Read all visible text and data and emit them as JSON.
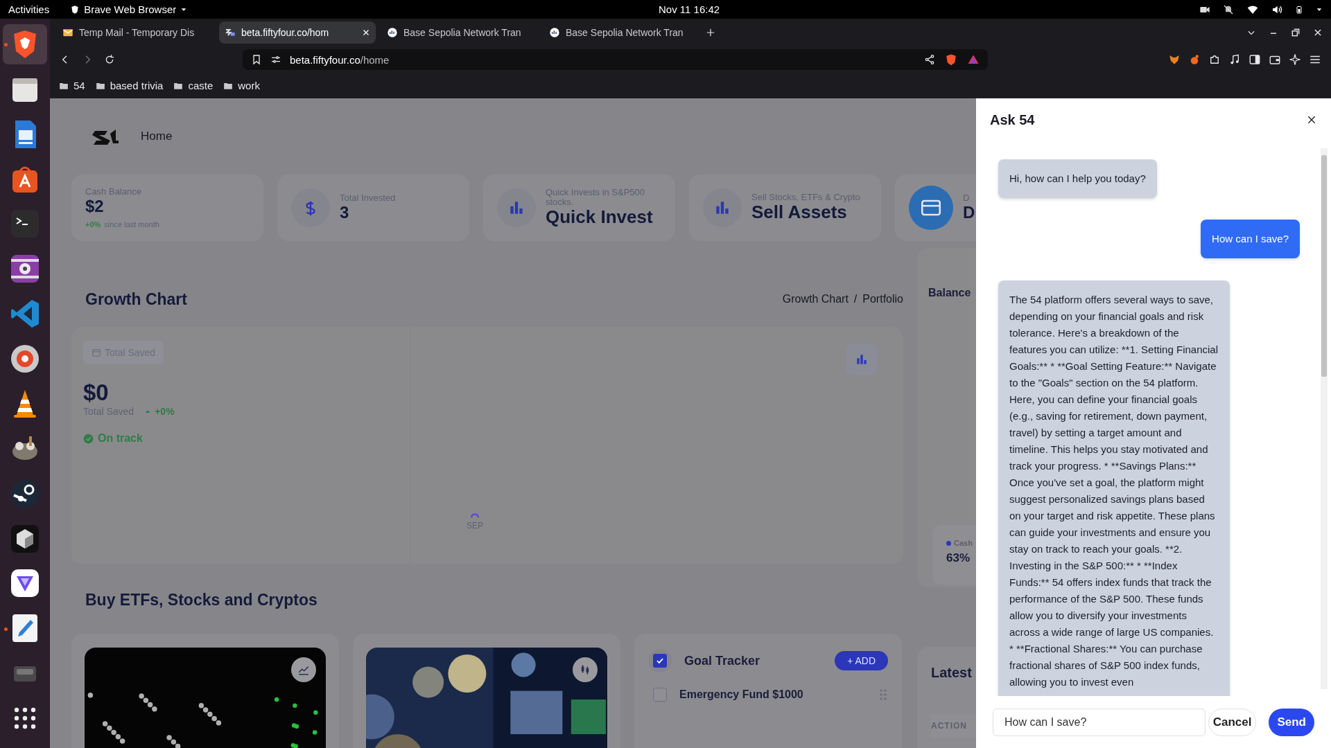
{
  "top_bar": {
    "activities": "Activities",
    "app_menu": "Brave Web Browser",
    "clock": "Nov 11  16:42"
  },
  "dock": [
    {
      "kind": "browser",
      "running": true
    },
    {
      "kind": "files",
      "running": false
    },
    {
      "kind": "writer",
      "running": false
    },
    {
      "kind": "store",
      "running": false
    },
    {
      "kind": "terminal",
      "running": false
    },
    {
      "kind": "video",
      "running": false
    },
    {
      "kind": "code",
      "running": false
    },
    {
      "kind": "disc",
      "running": false
    },
    {
      "kind": "cone",
      "running": false
    },
    {
      "kind": "paint",
      "running": false
    },
    {
      "kind": "gear",
      "running": false
    },
    {
      "kind": "cube",
      "running": false
    },
    {
      "kind": "triangle",
      "running": false
    },
    {
      "kind": "pencil",
      "running": true
    },
    {
      "kind": "drive",
      "running": false
    },
    {
      "kind": "grid",
      "running": false
    }
  ],
  "browser": {
    "tabs": [
      {
        "title": "Temp Mail - Temporary Dis",
        "selected": false,
        "kind": "mail"
      },
      {
        "title": "beta.fiftyfour.co/hom",
        "selected": true,
        "kind": "site"
      },
      {
        "title": "Base Sepolia Network Tran",
        "selected": false,
        "kind": "scan"
      },
      {
        "title": "Base Sepolia Network Tran",
        "selected": false,
        "kind": "scan"
      }
    ],
    "url_host": "beta.fiftyfour.co",
    "url_path": "/home",
    "bookmarks": [
      "54",
      "based trivia",
      "caste",
      "work"
    ]
  },
  "app": {
    "nav": "Home",
    "stats": [
      {
        "kind": "balance",
        "label": "Cash Balance",
        "value": "$2",
        "change": "+0%",
        "note": "since last month"
      },
      {
        "kind": "dollar",
        "label": "Total Invested",
        "value": "3"
      },
      {
        "kind": "bars",
        "label": "Quick Invests in S&P500 stocks.",
        "value": "Quick Invest"
      },
      {
        "kind": "bars",
        "label": "Sell Stocks, ETFs & Crypto",
        "value": "Sell Assets"
      },
      {
        "kind": "card",
        "label": "D",
        "value": "D"
      }
    ],
    "growth": {
      "title": "Growth Chart",
      "breadcrumb": [
        "Growth Chart",
        "Portfolio"
      ],
      "breadcrumb_separator": "/",
      "chip": "Total Saved",
      "amount": "$0",
      "amount_label": "Total Saved",
      "change": "+0%",
      "status": "On track",
      "x_label": "SEP"
    },
    "balance": {
      "title": "Balance",
      "legend": {
        "label": "Cash",
        "color": "#2b36b8"
      },
      "percent": "63%"
    },
    "buy": {
      "title": "Buy ETFs, Stocks and Cryptos",
      "cards": [
        {
          "kind": "chart"
        },
        {
          "kind": "candles"
        }
      ]
    },
    "goals": {
      "title": "Goal Tracker",
      "checked": true,
      "add": "+ ADD",
      "items": [
        {
          "name": "Emergency Fund $1000",
          "checked": false
        }
      ]
    },
    "latest": {
      "title": "Latest",
      "column": "ACTION"
    }
  },
  "chat": {
    "title": "Ask 54",
    "messages": [
      {
        "kind": "bot",
        "text": "Hi, how can I help you today?"
      },
      {
        "kind": "user",
        "text": "How can I save?"
      },
      {
        "kind": "bot",
        "text": "The 54 platform offers several ways to save, depending on your financial goals and risk tolerance. Here's a breakdown of the features you can utilize: **1. Setting Financial Goals:** * **Goal Setting Feature:** Navigate to the \"Goals\" section on the 54 platform. Here, you can define your financial goals (e.g., saving for retirement, down payment, travel) by setting a target amount and timeline. This helps you stay motivated and track your progress. * **Savings Plans:** Once you've set a goal, the platform might suggest personalized savings plans based on your target and risk appetite. These plans can guide your investments and ensure you stay on track to reach your goals. **2. Investing in the S&P 500:** * **Index Funds:** 54 offers index funds that track the performance of the S&P 500. These funds allow you to diversify your investments across a wide range of large US companies. * **Fractional Shares:** You can purchase fractional shares of S&P 500 index funds, allowing you to invest even"
      }
    ],
    "input": "How can I save?",
    "cancel": "Cancel",
    "send": "Send"
  }
}
